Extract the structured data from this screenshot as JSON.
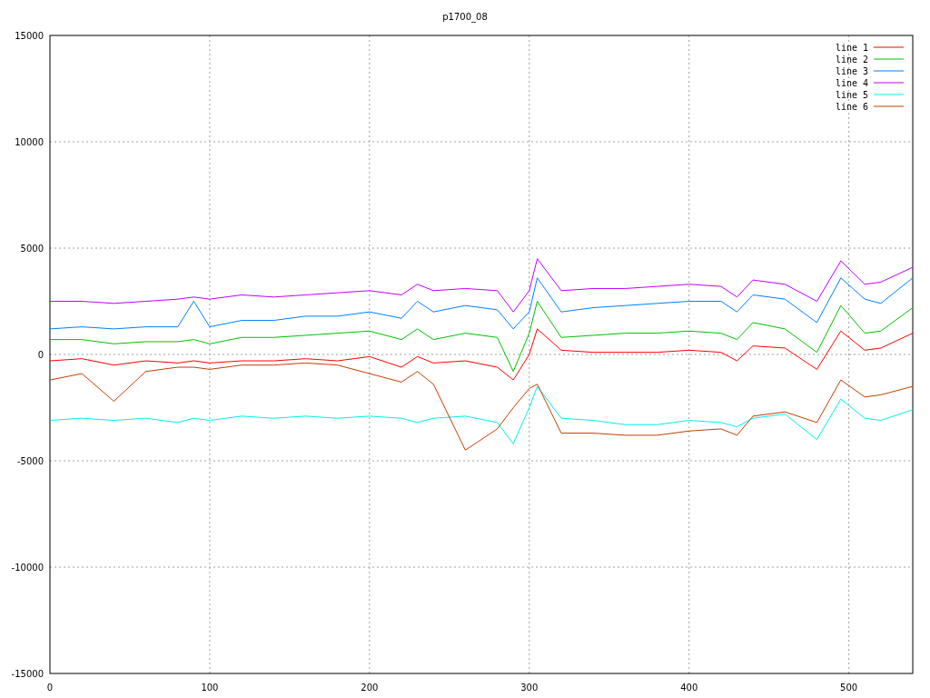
{
  "chart_data": {
    "type": "line",
    "title": "p1700_08",
    "x": [
      0,
      20,
      40,
      60,
      80,
      90,
      100,
      120,
      140,
      160,
      180,
      200,
      220,
      230,
      240,
      260,
      280,
      290,
      300,
      305,
      320,
      340,
      360,
      380,
      400,
      420,
      430,
      440,
      460,
      480,
      495,
      510,
      520,
      540
    ],
    "series": [
      {
        "name": "line 1",
        "color": "#ff0000",
        "values": [
          -300,
          -200,
          -500,
          -300,
          -400,
          -300,
          -400,
          -300,
          -300,
          -200,
          -300,
          -100,
          -600,
          -100,
          -400,
          -300,
          -600,
          -1200,
          0,
          1200,
          200,
          100,
          100,
          100,
          200,
          100,
          -300,
          400,
          300,
          -700,
          1100,
          200,
          300,
          1000
        ]
      },
      {
        "name": "line 2",
        "color": "#00c000",
        "values": [
          700,
          700,
          500,
          600,
          600,
          700,
          500,
          800,
          800,
          900,
          1000,
          1100,
          700,
          1200,
          700,
          1000,
          800,
          -800,
          1000,
          2500,
          800,
          900,
          1000,
          1000,
          1100,
          1000,
          700,
          1500,
          1200,
          100,
          2300,
          1000,
          1100,
          2200
        ]
      },
      {
        "name": "line 3",
        "color": "#0080ff",
        "values": [
          1200,
          1300,
          1200,
          1300,
          1300,
          2500,
          1300,
          1600,
          1600,
          1800,
          1800,
          2000,
          1700,
          2500,
          2000,
          2300,
          2100,
          1200,
          2000,
          3600,
          2000,
          2200,
          2300,
          2400,
          2500,
          2500,
          2000,
          2800,
          2600,
          1500,
          3600,
          2600,
          2400,
          3600
        ]
      },
      {
        "name": "line 4",
        "color": "#c000ff",
        "values": [
          2500,
          2500,
          2400,
          2500,
          2600,
          2700,
          2600,
          2800,
          2700,
          2800,
          2900,
          3000,
          2800,
          3300,
          3000,
          3100,
          3000,
          2000,
          3000,
          4500,
          3000,
          3100,
          3100,
          3200,
          3300,
          3200,
          2700,
          3500,
          3300,
          2500,
          4400,
          3300,
          3400,
          4100
        ]
      },
      {
        "name": "line 5",
        "color": "#00eeee",
        "values": [
          -3100,
          -3000,
          -3100,
          -3000,
          -3200,
          -3000,
          -3100,
          -2900,
          -3000,
          -2900,
          -3000,
          -2900,
          -3000,
          -3200,
          -3000,
          -2900,
          -3200,
          -4200,
          -2500,
          -1500,
          -3000,
          -3100,
          -3300,
          -3300,
          -3100,
          -3200,
          -3400,
          -3000,
          -2800,
          -4000,
          -2100,
          -3000,
          -3100,
          -2600
        ]
      },
      {
        "name": "line 6",
        "color": "#c04000",
        "values": [
          -1200,
          -900,
          -2200,
          -800,
          -600,
          -600,
          -700,
          -500,
          -500,
          -400,
          -500,
          -900,
          -1300,
          -800,
          -1400,
          -4500,
          -3500,
          -2500,
          -1600,
          -1400,
          -3700,
          -3700,
          -3800,
          -3800,
          -3600,
          -3500,
          -3800,
          -2900,
          -2700,
          -3200,
          -1200,
          -2000,
          -1900,
          -1500
        ]
      }
    ],
    "grid": true,
    "legend": true,
    "xlim": [
      0,
      540
    ],
    "ylim": [
      -15000,
      15000
    ],
    "xticks": [
      0,
      100,
      200,
      300,
      400,
      500
    ],
    "yticks": [
      -15000,
      -10000,
      -5000,
      0,
      5000,
      10000,
      15000
    ]
  }
}
